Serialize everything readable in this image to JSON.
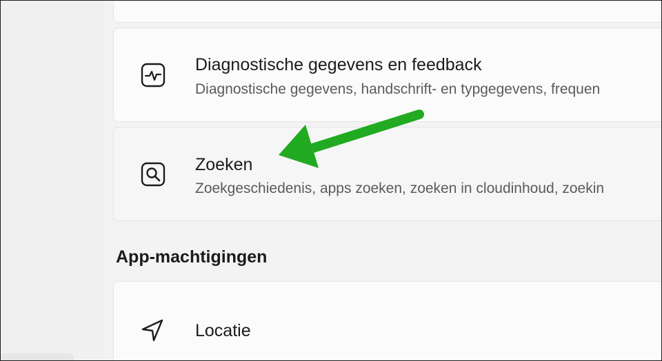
{
  "settings": {
    "items": [
      {
        "title": "Diagnostische gegevens en feedback",
        "description": "Diagnostische gegevens, handschrift- en typgegevens, frequen",
        "icon": "diagnostics-pulse-icon"
      },
      {
        "title": "Zoeken",
        "description": "Zoekgeschiedenis, apps zoeken, zoeken in cloudinhoud, zoekin",
        "icon": "search-icon"
      }
    ],
    "section_heading": "App-machtigingen",
    "section_items": [
      {
        "title": "Locatie",
        "icon": "location-arrow-icon"
      }
    ]
  },
  "annotation": {
    "color": "#22aa22",
    "points_to": "Zoeken"
  }
}
